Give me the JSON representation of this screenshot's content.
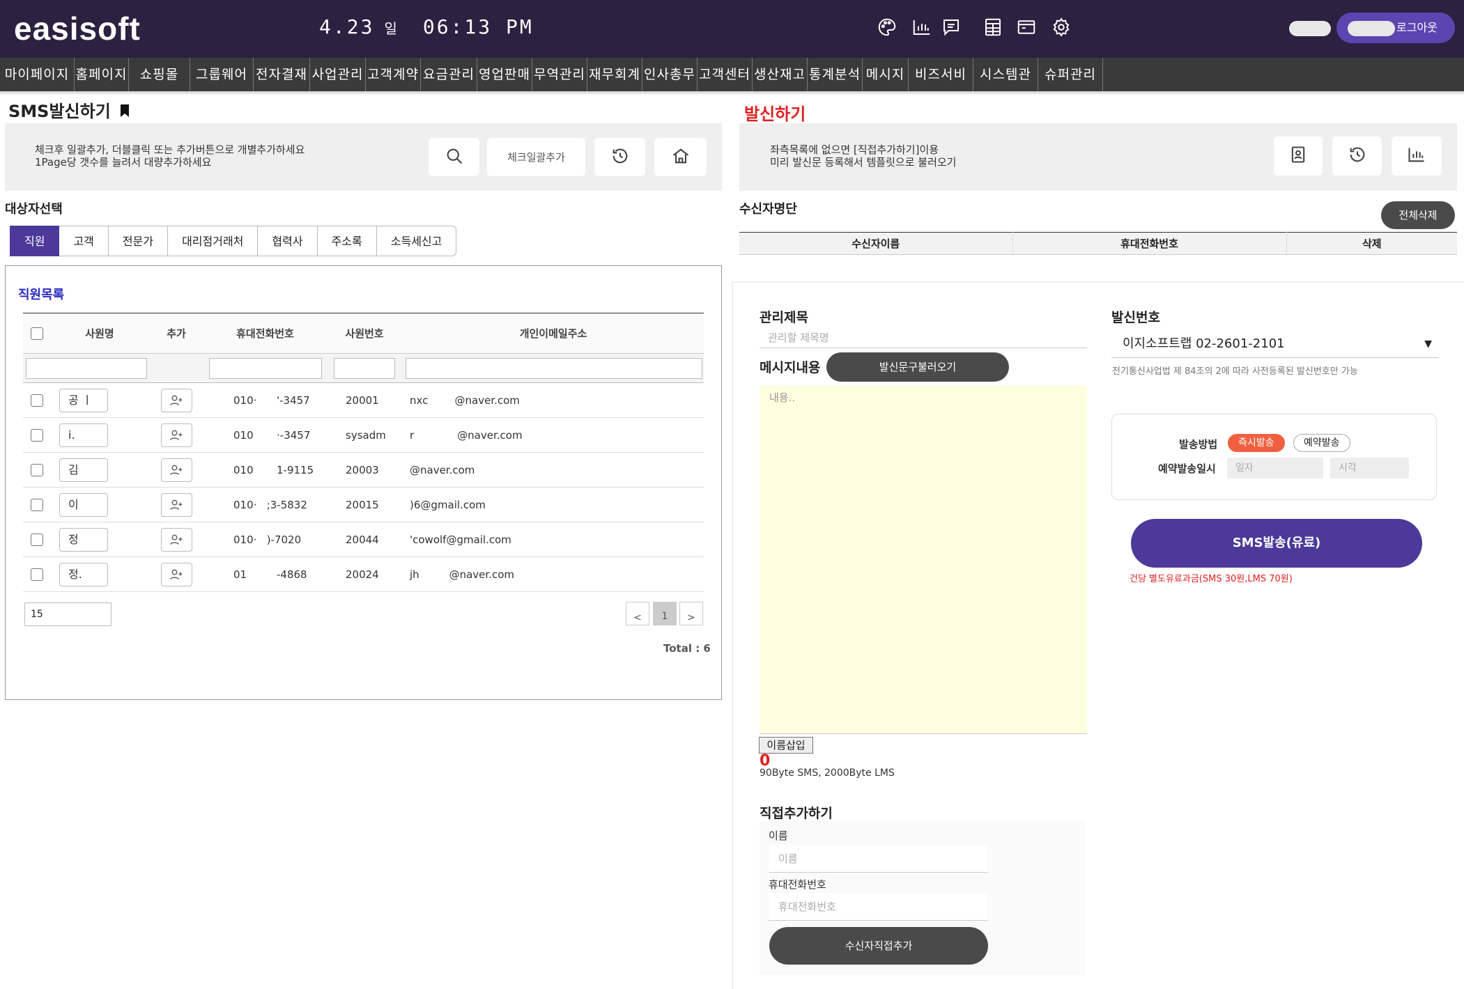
{
  "header": {
    "logo": "easisoft",
    "date": "4.23",
    "day": "일",
    "time": "06:13 PM",
    "icons": [
      "palette-icon",
      "chart-icon",
      "chat-icon",
      "calculator-icon",
      "window-icon",
      "gear-icon"
    ],
    "logout_label": "로그아웃",
    "accent": "#5b45b0",
    "bg_color": "#2b2140"
  },
  "menu": [
    "마이페이지",
    "홈페이지",
    "쇼핑몰",
    "그룹웨어",
    "전자결재",
    "사업관리",
    "고객계약",
    "요금관리",
    "영업판매",
    "무역관리",
    "재무회계",
    "인사총무",
    "고객센터",
    "생산재고",
    "통계분석",
    "메시지",
    "비즈서비스",
    "시스템관리",
    "슈퍼관리자"
  ],
  "left": {
    "title": "SMS발신하기",
    "hint1": "체크후 일괄추가, 더블클릭 또는 추가버튼으로 개별추가하세요",
    "hint2": "1Page당 갯수를 늘려서 대량추가하세요",
    "bulk_add_label": "체크일괄추가",
    "target_title": "대상자선택",
    "tabs": [
      "직원",
      "고객",
      "전문가",
      "대리점거래처",
      "협력사",
      "주소록",
      "소득세신고"
    ],
    "list_title": "직원목록",
    "columns": [
      "사원명",
      "추가",
      "휴대전화번호",
      "사원번호",
      "개인이메일주소"
    ],
    "rows": [
      {
        "name": "공   ㅣ",
        "phone": "010·      '-3457",
        "empno": "20001",
        "email": "nxc        @naver.com"
      },
      {
        "name": "i.",
        "phone": "010       ·-3457",
        "empno": "sysadm",
        "email": "r             @naver.com"
      },
      {
        "name": "김",
        "phone": "010       1-9115",
        "empno": "20003",
        "email": "@naver.com"
      },
      {
        "name": "이",
        "phone": "010·   ;3-5832",
        "empno": "20015",
        "email": ")6@gmail.com"
      },
      {
        "name": "정",
        "phone": "010·   )-7020",
        "empno": "20044",
        "email": "'cowolf@gmail.com"
      },
      {
        "name": "정.",
        "phone": "01         -4868",
        "empno": "20024",
        "email": "jh         @naver.com"
      }
    ],
    "page_size": "15",
    "pager": {
      "prev": "<",
      "current": "1",
      "next": ">"
    },
    "total": "Total : 6"
  },
  "right": {
    "title": "발신하기",
    "hint1": "좌측목록에 없으면 [직접추가하기]이용",
    "hint2": "미리 발신문 등록해서 템플릿으로 불러오기",
    "recipients_title": "수신자명단",
    "delete_all_label": "전체삭제",
    "recipient_columns": [
      "수신자이름",
      "휴대전화번호",
      "삭제"
    ],
    "mgmt_title_label": "관리제목",
    "mgmt_title_placeholder": "관리할 제목명",
    "message_label": "메시지내용",
    "load_message_label": "발신문구불러오기",
    "message_placeholder": "내용..",
    "name_insert_label": "이름삽입",
    "byte_count": "0",
    "byte_note": "90Byte SMS, 2000Byte LMS",
    "sender_label": "발신번호",
    "sender_value": "이지소프트랩 02-2601-2101",
    "sender_note": "전기통신사업법 제 84조의 2에 따라 사전등록된 발신번호만 가능",
    "method_label": "발송방법",
    "method_options": [
      "즉시발송",
      "예약발송"
    ],
    "schedule_label": "예약발송일시",
    "date_placeholder": "일자",
    "time_placeholder": "시각",
    "send_button": "SMS발송(유료)",
    "fee_note": "건당 별도유료과금(SMS 30원,LMS 70원)",
    "direct_title": "직접추가하기",
    "direct_name_label": "이름",
    "direct_name_placeholder": "이름",
    "direct_phone_label": "휴대전화번호",
    "direct_phone_placeholder": "휴대전화번호",
    "direct_add_label": "수신자직접추가",
    "alert_color": "#e02020"
  }
}
